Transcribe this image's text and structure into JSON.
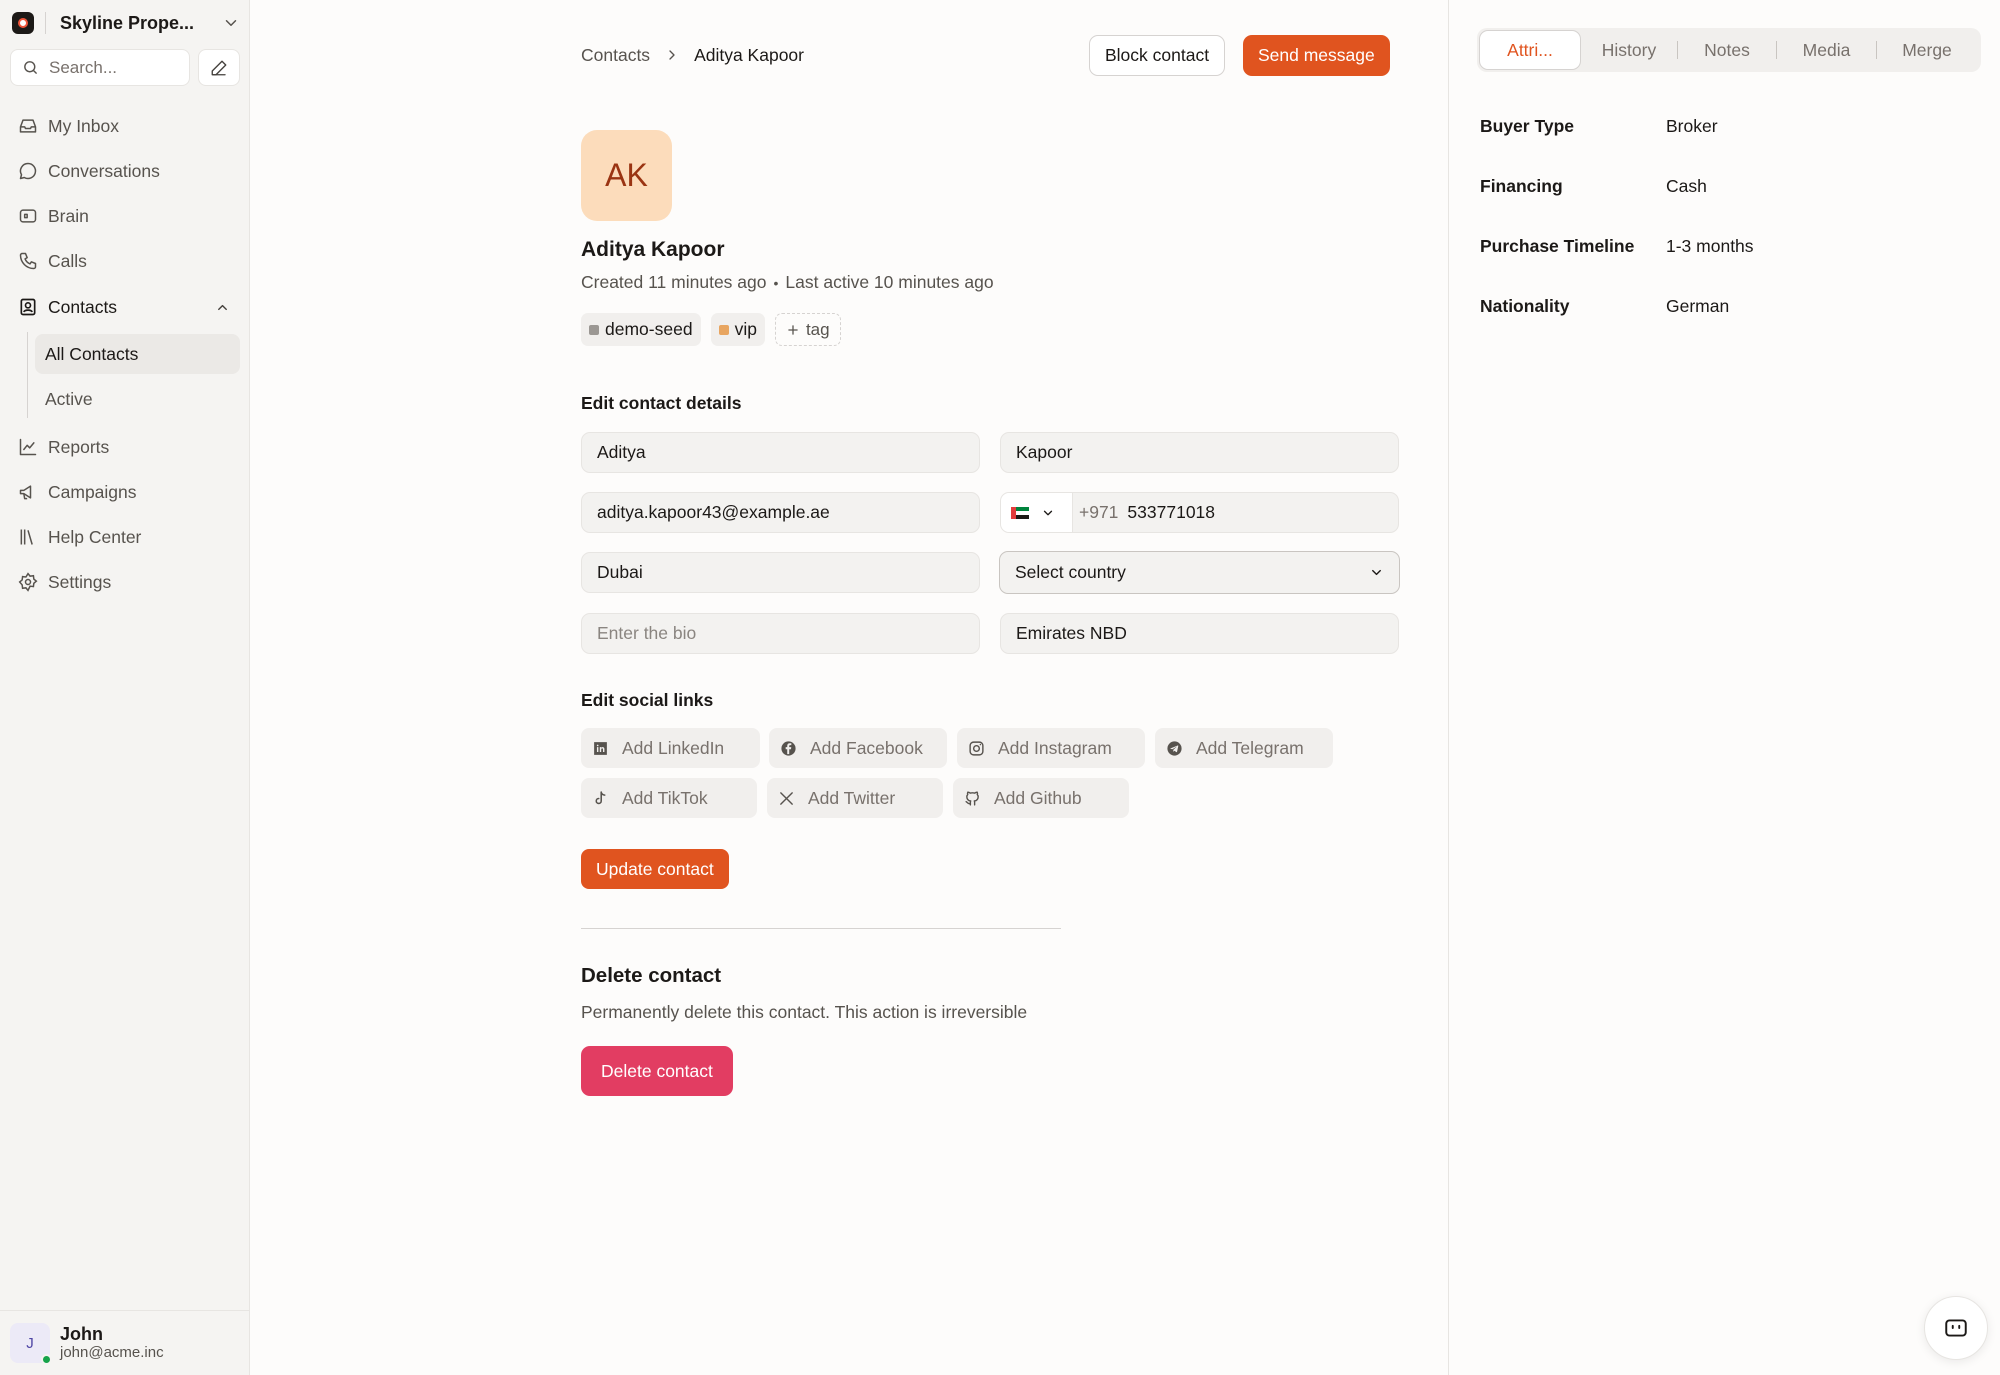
{
  "sidebar": {
    "workspace_name": "Skyline Prope...",
    "search_placeholder": "Search...",
    "nav": {
      "inbox": "My Inbox",
      "conversations": "Conversations",
      "brain": "Brain",
      "calls": "Calls",
      "contacts": "Contacts",
      "all_contacts": "All Contacts",
      "active": "Active",
      "reports": "Reports",
      "campaigns": "Campaigns",
      "help_center": "Help Center",
      "settings": "Settings"
    },
    "user": {
      "initial": "J",
      "name": "John",
      "email": "john@acme.inc"
    }
  },
  "breadcrumb": {
    "parent": "Contacts",
    "current": "Aditya Kapoor"
  },
  "header_actions": {
    "block": "Block contact",
    "send": "Send message"
  },
  "contact": {
    "initials": "AK",
    "name": "Aditya Kapoor",
    "created": "Created 11 minutes ago",
    "separator": "•",
    "last_active": "Last active 10 minutes ago",
    "tags": [
      {
        "label": "demo-seed",
        "color": "#9b9793"
      },
      {
        "label": "vip",
        "color": "#e8a560"
      }
    ],
    "add_tag": "tag"
  },
  "edit_details": {
    "heading": "Edit contact details",
    "first_name": "Aditya",
    "last_name": "Kapoor",
    "email": "aditya.kapoor43@example.ae",
    "phone_prefix": "+971",
    "phone_number": "533771018",
    "city": "Dubai",
    "country_placeholder": "Select country",
    "bio_placeholder": "Enter the bio",
    "company": "Emirates NBD"
  },
  "social": {
    "heading": "Edit social links",
    "linkedin": "Add LinkedIn",
    "facebook": "Add Facebook",
    "instagram": "Add Instagram",
    "telegram": "Add Telegram",
    "tiktok": "Add TikTok",
    "twitter": "Add Twitter",
    "github": "Add Github"
  },
  "update_button": "Update contact",
  "delete_section": {
    "title": "Delete contact",
    "description": "Permanently delete this contact. This action is irreversible",
    "button": "Delete contact"
  },
  "right_panel": {
    "tabs": [
      "Attri...",
      "History",
      "Notes",
      "Media",
      "Merge"
    ],
    "attributes": [
      {
        "key": "Buyer Type",
        "value": "Broker"
      },
      {
        "key": "Financing",
        "value": "Cash"
      },
      {
        "key": "Purchase Timeline",
        "value": "1-3 months"
      },
      {
        "key": "Nationality",
        "value": "German"
      }
    ]
  },
  "colors": {
    "accent": "#e0541f",
    "danger": "#e23d62",
    "avatar_bg": "#fcdcbb"
  }
}
